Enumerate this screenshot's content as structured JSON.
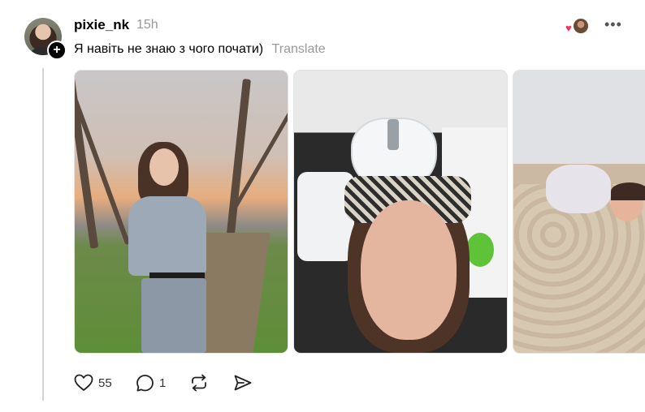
{
  "post": {
    "username": "pixie_nk",
    "time": "15h",
    "text": "Я навіть не знаю з чого почати)",
    "translate_label": "Translate",
    "follow_symbol": "+",
    "more_symbol": "•••",
    "heart_symbol": "♥"
  },
  "actions": {
    "likes": "55",
    "comments": "1"
  },
  "icons": {
    "like": "heart-icon",
    "comment": "comment-icon",
    "repost": "repost-icon",
    "share": "share-icon",
    "more": "more-icon"
  },
  "colors": {
    "text": "#000000",
    "muted": "#999999",
    "heart_reaction": "#ff2d55",
    "thread_line": "#d4d4d4"
  }
}
